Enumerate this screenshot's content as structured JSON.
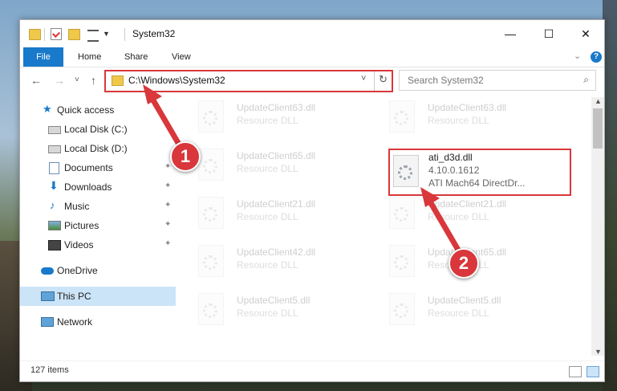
{
  "window": {
    "title": "System32",
    "minimize_glyph": "—",
    "maximize_glyph": "☐",
    "close_glyph": "✕"
  },
  "ribbon": {
    "tabs": [
      "File",
      "Home",
      "Share",
      "View"
    ],
    "expand_glyph": "⌄",
    "help_glyph": "?"
  },
  "nav": {
    "back_glyph": "←",
    "forward_glyph": "→",
    "recent_glyph": "˅",
    "up_glyph": "↑"
  },
  "address": {
    "path": "C:\\Windows\\System32",
    "dropdown_glyph": "˅",
    "refresh_glyph": "↻"
  },
  "search": {
    "placeholder": "Search System32",
    "icon_glyph": "⌕"
  },
  "sidebar": {
    "items": [
      {
        "label": "Quick access",
        "icon": "star-icon",
        "pinned": false
      },
      {
        "label": "Local Disk (C:)",
        "icon": "drive-icon",
        "pinned": true
      },
      {
        "label": "Local Disk (D:)",
        "icon": "drive-icon",
        "pinned": true
      },
      {
        "label": "Documents",
        "icon": "documents-icon",
        "pinned": true
      },
      {
        "label": "Downloads",
        "icon": "downloads-icon",
        "pinned": true
      },
      {
        "label": "Music",
        "icon": "music-icon",
        "pinned": true
      },
      {
        "label": "Pictures",
        "icon": "pictures-icon",
        "pinned": true
      },
      {
        "label": "Videos",
        "icon": "videos-icon",
        "pinned": true
      },
      {
        "label": "OneDrive",
        "icon": "cloud-icon",
        "pinned": false
      },
      {
        "label": "This PC",
        "icon": "computer-icon",
        "pinned": false,
        "selected": true
      },
      {
        "label": "Network",
        "icon": "network-icon",
        "pinned": false
      }
    ],
    "pin_glyph": "📌"
  },
  "files": [
    {
      "name": "UpdateClient63.dll",
      "desc": "Resource DLL"
    },
    {
      "name": "UpdateClient63.dll",
      "desc": "Resource DLL"
    },
    {
      "name": "UpdateClient65.dll",
      "desc": "Resource DLL"
    },
    {
      "name": "UpdateClient21.dll",
      "desc": "Resource DLL"
    },
    {
      "name": "UpdateClient21.dll",
      "desc": "Resource DLL"
    },
    {
      "name": "UpdateClient42.dll",
      "desc": "Resource DLL"
    },
    {
      "name": "UpdateClient65.dll",
      "desc": "Resource DLL"
    },
    {
      "name": "UpdateClient5.dll",
      "desc": "Resource DLL"
    },
    {
      "name": "UpdateClient5.dll",
      "desc": "Resource DLL"
    }
  ],
  "highlighted_file": {
    "name": "ati_d3d.dll",
    "version": "4.10.0.1612",
    "desc": "ATI Mach64 DirectDr..."
  },
  "status": {
    "item_count": "127 items"
  },
  "callouts": {
    "one": "1",
    "two": "2"
  },
  "colors": {
    "accent": "#1979ca",
    "highlight_red": "#d9373b",
    "selection": "#cce4f7"
  }
}
